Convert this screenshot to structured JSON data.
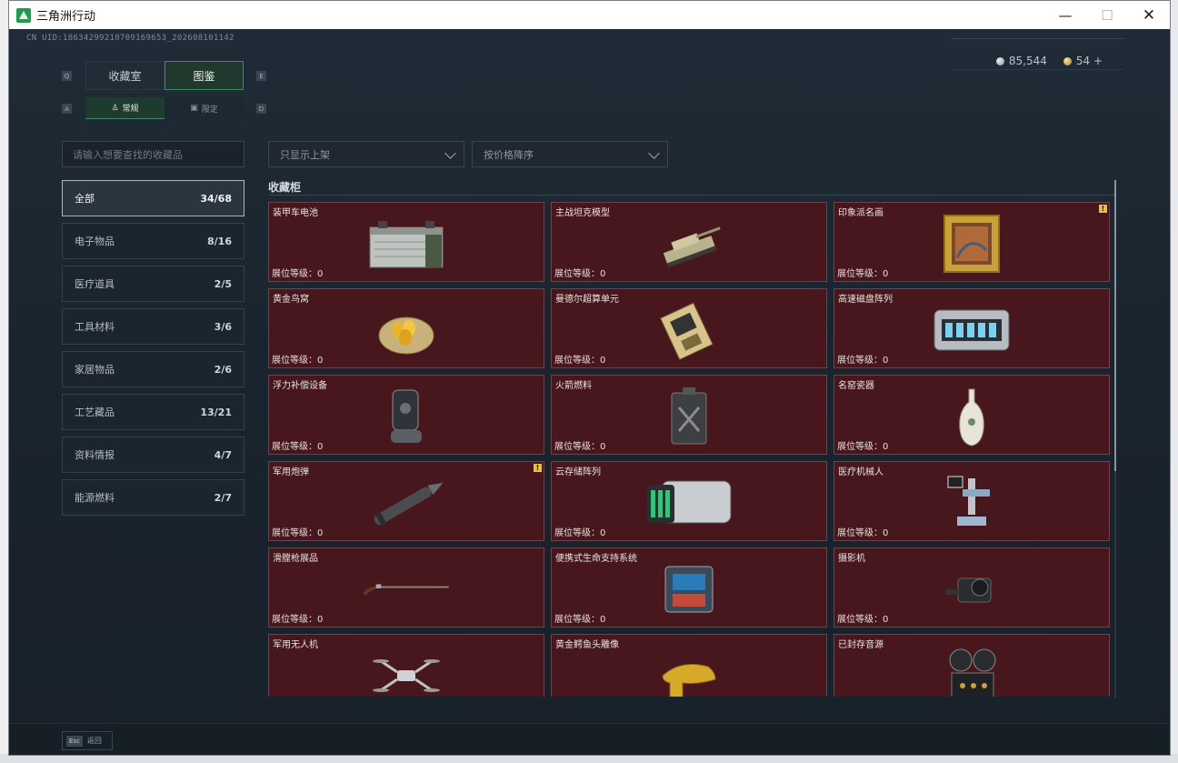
{
  "window": {
    "title": "三角洲行动",
    "min_icon": "—",
    "max_icon": "☐",
    "close_icon": "✕"
  },
  "uid": "CN UID:18634299210709169653_202608101142",
  "currency": {
    "silver": "85,544",
    "gold": "54 +"
  },
  "keys": {
    "q": "Q",
    "e": "E",
    "a": "A",
    "d": "D"
  },
  "tabs": {
    "primary": [
      {
        "label": "收藏室",
        "active": false
      },
      {
        "label": "图鉴",
        "active": true
      }
    ],
    "secondary": [
      {
        "label": "常规",
        "active": true
      },
      {
        "label": "限定",
        "active": false
      }
    ]
  },
  "search": {
    "placeholder": "请输入想要查找的收藏品"
  },
  "filters": {
    "shelf_filter": "只显示上架",
    "sort": "按价格降序"
  },
  "categories": [
    {
      "label": "全部",
      "count": "34/68",
      "active": true
    },
    {
      "label": "电子物品",
      "count": "8/16"
    },
    {
      "label": "医疗道具",
      "count": "2/5"
    },
    {
      "label": "工具材料",
      "count": "3/6"
    },
    {
      "label": "家居物品",
      "count": "2/6"
    },
    {
      "label": "工艺藏品",
      "count": "13/21"
    },
    {
      "label": "资料情报",
      "count": "4/7"
    },
    {
      "label": "能源燃料",
      "count": "2/7"
    }
  ],
  "section": {
    "title": "收藏柜"
  },
  "level_label": "展位等级：0",
  "items": [
    {
      "name": "装甲车电池",
      "icon": "battery-icon",
      "warn": false
    },
    {
      "name": "主战坦克模型",
      "icon": "tank-icon",
      "warn": false
    },
    {
      "name": "印象派名画",
      "icon": "painting-icon",
      "warn": true
    },
    {
      "name": "黄金鸟窝",
      "icon": "nest-icon",
      "warn": false
    },
    {
      "name": "曼德尔超算单元",
      "icon": "chip-icon",
      "warn": false
    },
    {
      "name": "高速磁盘阵列",
      "icon": "disk-array-icon",
      "warn": false
    },
    {
      "name": "浮力补偿设备",
      "icon": "buoyancy-icon",
      "warn": false
    },
    {
      "name": "火箭燃料",
      "icon": "fuel-can-icon",
      "warn": false
    },
    {
      "name": "名窑瓷器",
      "icon": "vase-icon",
      "warn": false
    },
    {
      "name": "军用炮弹",
      "icon": "shell-icon",
      "warn": true
    },
    {
      "name": "云存储阵列",
      "icon": "storage-icon",
      "warn": false
    },
    {
      "name": "医疗机械人",
      "icon": "robot-icon",
      "warn": false
    },
    {
      "name": "滑膛枪展品",
      "icon": "musket-icon",
      "warn": false
    },
    {
      "name": "便携式生命支持系统",
      "icon": "life-support-icon",
      "warn": false
    },
    {
      "name": "摄影机",
      "icon": "camera-icon",
      "warn": false
    },
    {
      "name": "军用无人机",
      "icon": "drone-icon",
      "warn": false
    },
    {
      "name": "黄金鳄鱼头雕像",
      "icon": "croc-icon",
      "warn": false
    },
    {
      "name": "已封存音源",
      "icon": "reel-icon",
      "warn": false
    }
  ],
  "footer": {
    "esc_key": "Esc",
    "back": "返回"
  },
  "colors": {
    "card_bg": "#48171d",
    "accent": "#3e8a68",
    "warn": "#e6c04a"
  }
}
